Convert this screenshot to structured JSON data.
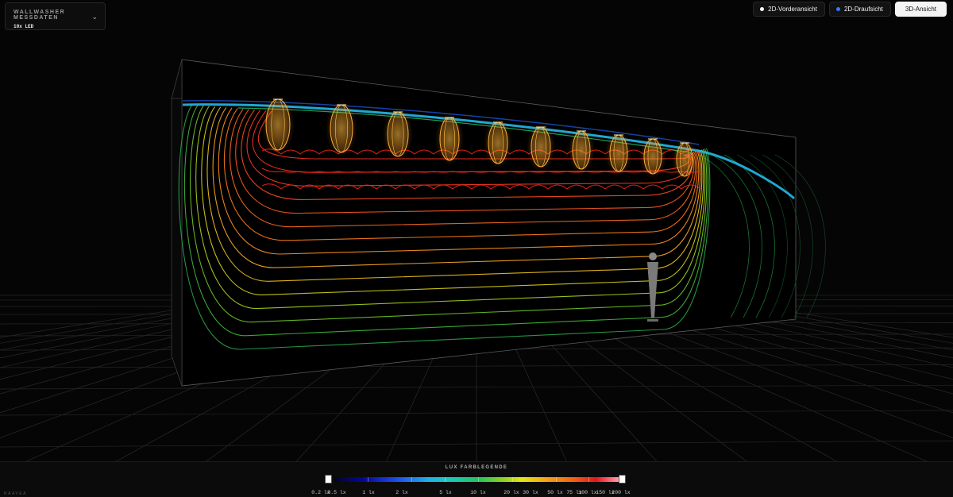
{
  "dataset": {
    "title": "WALLWASHER MESSDATEN",
    "subtitle": "10x LED",
    "chevron_icon": "chevron-down-icon"
  },
  "views": [
    {
      "label": "2D-Vorderansicht",
      "dot_color": "#ffffff",
      "active": false
    },
    {
      "label": "2D-Draufsicht",
      "dot_color": "#2f7bff",
      "active": false
    },
    {
      "label": "3D-Ansicht",
      "dot_color": "",
      "active": true
    }
  ],
  "legend": {
    "title": "LUX FARBLEGENDE",
    "ticks": [
      "0.2 lx",
      "0.5 lx",
      "1 lx",
      "2 lx",
      "5 lx",
      "10 lx",
      "20 lx",
      "30 lx",
      "50 lx",
      "75 lx",
      "100 lx",
      "150 lx",
      "200 lx"
    ]
  },
  "brand": "RAAVEA",
  "colors": {
    "background": "#050505",
    "panel": "#0d0d0d",
    "active_tab": "#f4f4f4"
  }
}
